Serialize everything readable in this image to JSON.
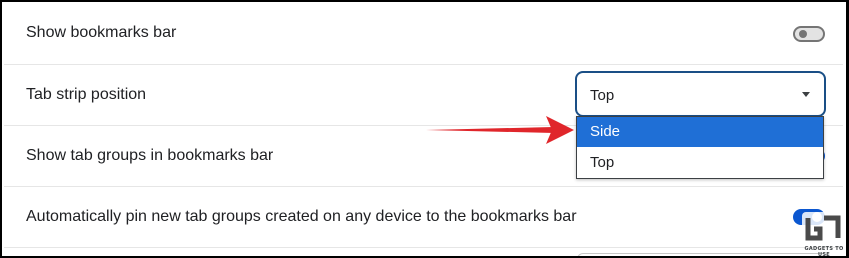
{
  "settings": {
    "rows": [
      {
        "label": "Show bookmarks bar",
        "control": "toggle",
        "state": "off"
      },
      {
        "label": "Tab strip position",
        "control": "select",
        "value": "Top"
      },
      {
        "label": "Show tab groups in bookmarks bar",
        "control": "toggle",
        "state": "on"
      },
      {
        "label": "Automatically pin new tab groups created on any device to the bookmarks bar",
        "control": "toggle",
        "state": "on"
      }
    ]
  },
  "dropdown": {
    "options": [
      "Side",
      "Top"
    ],
    "highlighted": "Side"
  },
  "watermark": {
    "text": "GADGETS TO USE"
  },
  "colors": {
    "accent": "#0b57d0",
    "highlight": "#1f6fd6",
    "arrow": "#e0262b"
  }
}
